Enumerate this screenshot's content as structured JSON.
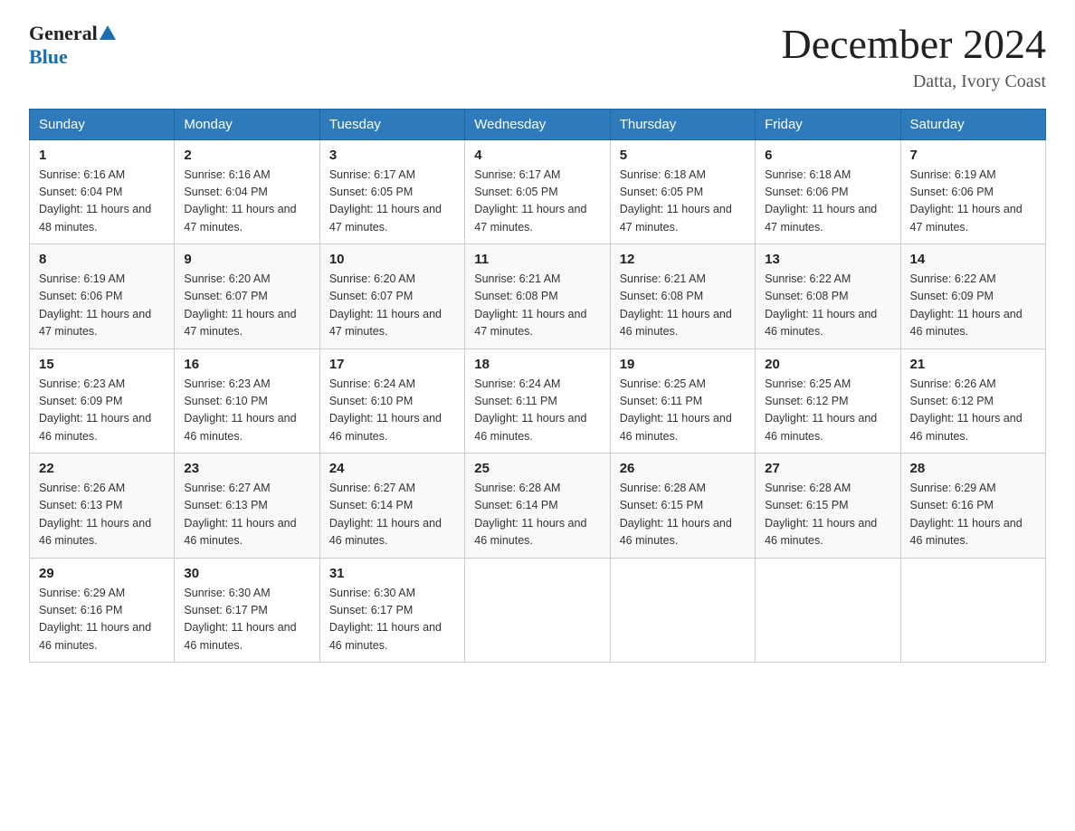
{
  "header": {
    "title": "December 2024",
    "subtitle": "Datta, Ivory Coast",
    "logo_general": "General",
    "logo_blue": "Blue"
  },
  "days_of_week": [
    "Sunday",
    "Monday",
    "Tuesday",
    "Wednesday",
    "Thursday",
    "Friday",
    "Saturday"
  ],
  "weeks": [
    [
      {
        "day": "1",
        "sunrise": "6:16 AM",
        "sunset": "6:04 PM",
        "daylight": "11 hours and 48 minutes."
      },
      {
        "day": "2",
        "sunrise": "6:16 AM",
        "sunset": "6:04 PM",
        "daylight": "11 hours and 47 minutes."
      },
      {
        "day": "3",
        "sunrise": "6:17 AM",
        "sunset": "6:05 PM",
        "daylight": "11 hours and 47 minutes."
      },
      {
        "day": "4",
        "sunrise": "6:17 AM",
        "sunset": "6:05 PM",
        "daylight": "11 hours and 47 minutes."
      },
      {
        "day": "5",
        "sunrise": "6:18 AM",
        "sunset": "6:05 PM",
        "daylight": "11 hours and 47 minutes."
      },
      {
        "day": "6",
        "sunrise": "6:18 AM",
        "sunset": "6:06 PM",
        "daylight": "11 hours and 47 minutes."
      },
      {
        "day": "7",
        "sunrise": "6:19 AM",
        "sunset": "6:06 PM",
        "daylight": "11 hours and 47 minutes."
      }
    ],
    [
      {
        "day": "8",
        "sunrise": "6:19 AM",
        "sunset": "6:06 PM",
        "daylight": "11 hours and 47 minutes."
      },
      {
        "day": "9",
        "sunrise": "6:20 AM",
        "sunset": "6:07 PM",
        "daylight": "11 hours and 47 minutes."
      },
      {
        "day": "10",
        "sunrise": "6:20 AM",
        "sunset": "6:07 PM",
        "daylight": "11 hours and 47 minutes."
      },
      {
        "day": "11",
        "sunrise": "6:21 AM",
        "sunset": "6:08 PM",
        "daylight": "11 hours and 47 minutes."
      },
      {
        "day": "12",
        "sunrise": "6:21 AM",
        "sunset": "6:08 PM",
        "daylight": "11 hours and 46 minutes."
      },
      {
        "day": "13",
        "sunrise": "6:22 AM",
        "sunset": "6:08 PM",
        "daylight": "11 hours and 46 minutes."
      },
      {
        "day": "14",
        "sunrise": "6:22 AM",
        "sunset": "6:09 PM",
        "daylight": "11 hours and 46 minutes."
      }
    ],
    [
      {
        "day": "15",
        "sunrise": "6:23 AM",
        "sunset": "6:09 PM",
        "daylight": "11 hours and 46 minutes."
      },
      {
        "day": "16",
        "sunrise": "6:23 AM",
        "sunset": "6:10 PM",
        "daylight": "11 hours and 46 minutes."
      },
      {
        "day": "17",
        "sunrise": "6:24 AM",
        "sunset": "6:10 PM",
        "daylight": "11 hours and 46 minutes."
      },
      {
        "day": "18",
        "sunrise": "6:24 AM",
        "sunset": "6:11 PM",
        "daylight": "11 hours and 46 minutes."
      },
      {
        "day": "19",
        "sunrise": "6:25 AM",
        "sunset": "6:11 PM",
        "daylight": "11 hours and 46 minutes."
      },
      {
        "day": "20",
        "sunrise": "6:25 AM",
        "sunset": "6:12 PM",
        "daylight": "11 hours and 46 minutes."
      },
      {
        "day": "21",
        "sunrise": "6:26 AM",
        "sunset": "6:12 PM",
        "daylight": "11 hours and 46 minutes."
      }
    ],
    [
      {
        "day": "22",
        "sunrise": "6:26 AM",
        "sunset": "6:13 PM",
        "daylight": "11 hours and 46 minutes."
      },
      {
        "day": "23",
        "sunrise": "6:27 AM",
        "sunset": "6:13 PM",
        "daylight": "11 hours and 46 minutes."
      },
      {
        "day": "24",
        "sunrise": "6:27 AM",
        "sunset": "6:14 PM",
        "daylight": "11 hours and 46 minutes."
      },
      {
        "day": "25",
        "sunrise": "6:28 AM",
        "sunset": "6:14 PM",
        "daylight": "11 hours and 46 minutes."
      },
      {
        "day": "26",
        "sunrise": "6:28 AM",
        "sunset": "6:15 PM",
        "daylight": "11 hours and 46 minutes."
      },
      {
        "day": "27",
        "sunrise": "6:28 AM",
        "sunset": "6:15 PM",
        "daylight": "11 hours and 46 minutes."
      },
      {
        "day": "28",
        "sunrise": "6:29 AM",
        "sunset": "6:16 PM",
        "daylight": "11 hours and 46 minutes."
      }
    ],
    [
      {
        "day": "29",
        "sunrise": "6:29 AM",
        "sunset": "6:16 PM",
        "daylight": "11 hours and 46 minutes."
      },
      {
        "day": "30",
        "sunrise": "6:30 AM",
        "sunset": "6:17 PM",
        "daylight": "11 hours and 46 minutes."
      },
      {
        "day": "31",
        "sunrise": "6:30 AM",
        "sunset": "6:17 PM",
        "daylight": "11 hours and 46 minutes."
      },
      {
        "day": "",
        "sunrise": "",
        "sunset": "",
        "daylight": ""
      },
      {
        "day": "",
        "sunrise": "",
        "sunset": "",
        "daylight": ""
      },
      {
        "day": "",
        "sunrise": "",
        "sunset": "",
        "daylight": ""
      },
      {
        "day": "",
        "sunrise": "",
        "sunset": "",
        "daylight": ""
      }
    ]
  ]
}
